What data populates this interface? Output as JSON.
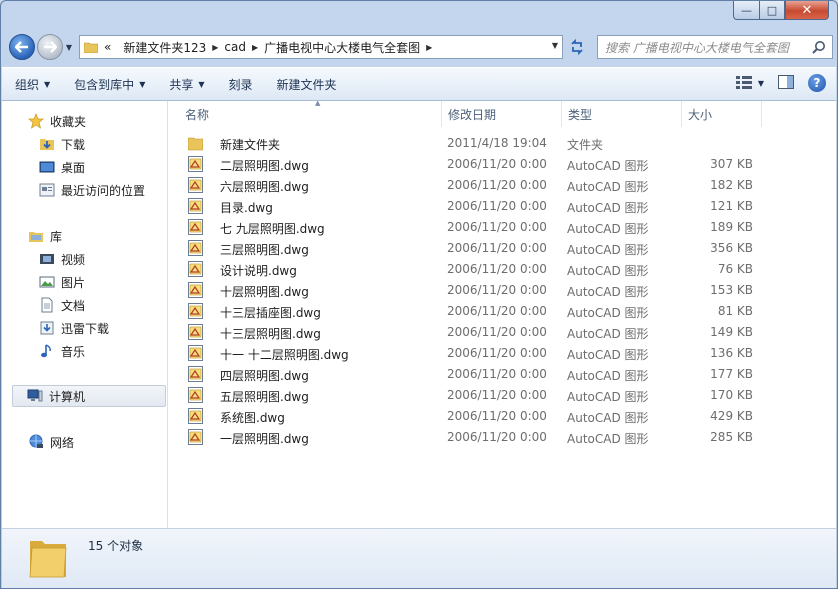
{
  "window": {
    "minimize": "—",
    "maximize": "□",
    "close": "✕"
  },
  "address": {
    "overflow": "«",
    "crumbs": [
      "新建文件夹123",
      "cad",
      "广播电视中心大楼电气全套图"
    ]
  },
  "search": {
    "placeholder": "搜索 广播电视中心大楼电气全套图"
  },
  "toolbar": {
    "organize": "组织",
    "include_library": "包含到库中",
    "share": "共享",
    "burn": "刻录",
    "new_folder": "新建文件夹"
  },
  "sidebar": {
    "favorites": "收藏夹",
    "downloads": "下载",
    "desktop": "桌面",
    "recent": "最近访问的位置",
    "libraries": "库",
    "videos": "视频",
    "pictures": "图片",
    "documents": "文档",
    "xunlei": "迅雷下载",
    "music": "音乐",
    "computer": "计算机",
    "network": "网络"
  },
  "columns": {
    "name": "名称",
    "date": "修改日期",
    "type": "类型",
    "size": "大小"
  },
  "files": [
    {
      "name": "新建文件夹",
      "date": "2011/4/18 19:04",
      "type": "文件夹",
      "size": "",
      "kind": "folder"
    },
    {
      "name": "二层照明图.dwg",
      "date": "2006/11/20 0:00",
      "type": "AutoCAD 图形",
      "size": "307 KB",
      "kind": "dwg"
    },
    {
      "name": "六层照明图.dwg",
      "date": "2006/11/20 0:00",
      "type": "AutoCAD 图形",
      "size": "182 KB",
      "kind": "dwg"
    },
    {
      "name": "目录.dwg",
      "date": "2006/11/20 0:00",
      "type": "AutoCAD 图形",
      "size": "121 KB",
      "kind": "dwg"
    },
    {
      "name": "七  九层照明图.dwg",
      "date": "2006/11/20 0:00",
      "type": "AutoCAD 图形",
      "size": "189 KB",
      "kind": "dwg"
    },
    {
      "name": "三层照明图.dwg",
      "date": "2006/11/20 0:00",
      "type": "AutoCAD 图形",
      "size": "356 KB",
      "kind": "dwg"
    },
    {
      "name": "设计说明.dwg",
      "date": "2006/11/20 0:00",
      "type": "AutoCAD 图形",
      "size": "76 KB",
      "kind": "dwg"
    },
    {
      "name": "十层照明图.dwg",
      "date": "2006/11/20 0:00",
      "type": "AutoCAD 图形",
      "size": "153 KB",
      "kind": "dwg"
    },
    {
      "name": "十三层插座图.dwg",
      "date": "2006/11/20 0:00",
      "type": "AutoCAD 图形",
      "size": "81 KB",
      "kind": "dwg"
    },
    {
      "name": "十三层照明图.dwg",
      "date": "2006/11/20 0:00",
      "type": "AutoCAD 图形",
      "size": "149 KB",
      "kind": "dwg"
    },
    {
      "name": "十一 十二层照明图.dwg",
      "date": "2006/11/20 0:00",
      "type": "AutoCAD 图形",
      "size": "136 KB",
      "kind": "dwg"
    },
    {
      "name": "四层照明图.dwg",
      "date": "2006/11/20 0:00",
      "type": "AutoCAD 图形",
      "size": "177 KB",
      "kind": "dwg"
    },
    {
      "name": "五层照明图.dwg",
      "date": "2006/11/20 0:00",
      "type": "AutoCAD 图形",
      "size": "170 KB",
      "kind": "dwg"
    },
    {
      "name": "系统图.dwg",
      "date": "2006/11/20 0:00",
      "type": "AutoCAD 图形",
      "size": "429 KB",
      "kind": "dwg"
    },
    {
      "name": "一层照明图.dwg",
      "date": "2006/11/20 0:00",
      "type": "AutoCAD 图形",
      "size": "285 KB",
      "kind": "dwg"
    }
  ],
  "status": {
    "count": "15 个对象"
  },
  "icons": {
    "back": "back-arrow-icon",
    "forward": "forward-arrow-icon",
    "folder": "folder-icon",
    "dwg": "autocad-drawing-icon",
    "search": "search-icon",
    "refresh": "refresh-icon",
    "help": "help-icon",
    "views": "views-icon",
    "preview": "preview-pane-icon"
  },
  "colors": {
    "window_frame": "#c4d6ee",
    "selection": "#e3e9f1",
    "folder": "#e8c45a",
    "text_gray": "#6d6d6d"
  }
}
